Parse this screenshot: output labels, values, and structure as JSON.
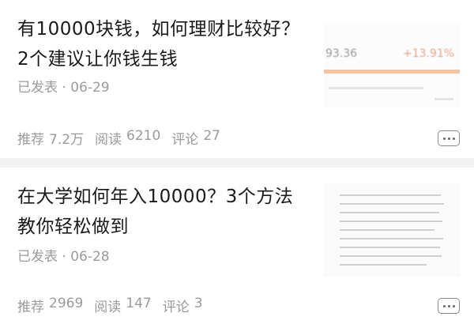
{
  "articles": [
    {
      "title": "有10000块钱，如何理财比较好？2个建议让你钱生钱",
      "published_label": "已发表",
      "date": "06-29",
      "stats": {
        "recommend_label": "推荐",
        "recommend_value": "7.2万",
        "read_label": "阅读",
        "read_value": "6210",
        "comment_label": "评论",
        "comment_value": "27"
      },
      "thumbnail": {
        "value_left": "93.36",
        "value_right": "+13.91%"
      }
    },
    {
      "title": "在大学如何年入10000？3个方法教你轻松做到",
      "published_label": "已发表",
      "date": "06-28",
      "stats": {
        "recommend_label": "推荐",
        "recommend_value": "2969",
        "read_label": "阅读",
        "read_value": "147",
        "comment_label": "评论",
        "comment_value": "3"
      }
    }
  ],
  "separator": "·",
  "colors": {
    "meta_text": "#9b9b9b",
    "divider": "#f2f2f2",
    "thumb_bar": "#f3c4a2"
  }
}
